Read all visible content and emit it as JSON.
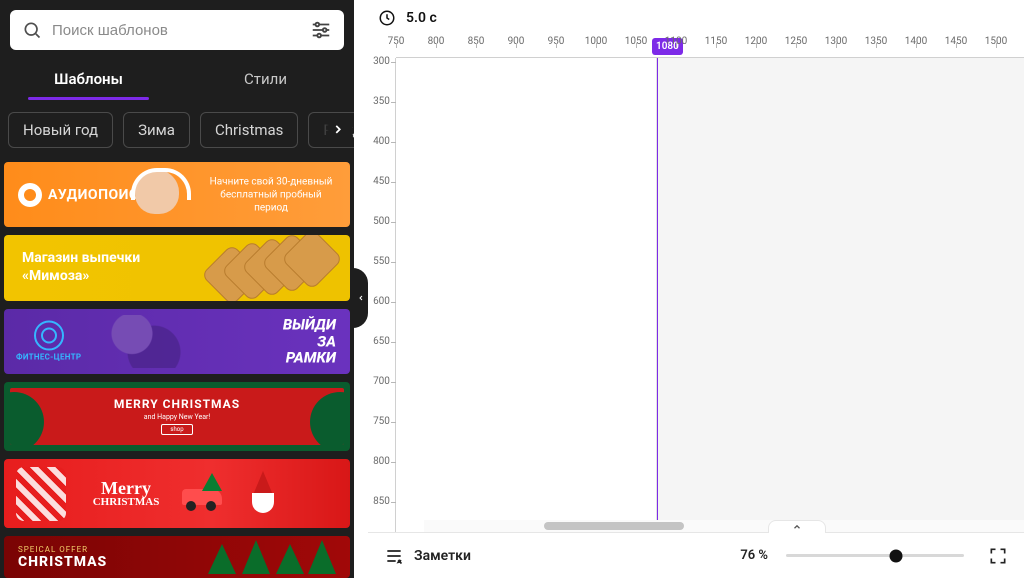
{
  "search": {
    "placeholder": "Поиск шаблонов"
  },
  "tabs": {
    "templates": "Шаблоны",
    "styles": "Стили"
  },
  "chips": [
    "Новый год",
    "Зима",
    "Christmas",
    "Рождес"
  ],
  "templates": {
    "t1": {
      "logo": "АУДИОПОИСК",
      "text": "Начните свой 30-дневный бесплатный пробный период"
    },
    "t2": {
      "line1": "Магазин выпечки",
      "line2": "«Мимоза»"
    },
    "t3": {
      "logo": "ФИТНЕС-ЦЕНТР",
      "line1": "ВЫЙДИ",
      "line2": "ЗА",
      "line3": "РАМКИ"
    },
    "t4": {
      "title": "MERRY CHRISTMAS",
      "sub": "and Happy New Year!",
      "btn": "shop"
    },
    "t5": {
      "line1": "Merry",
      "line2": "CHRISTMAS"
    },
    "t6": {
      "sub": "SPEICAL OFFER",
      "title": "CHRISTMAS"
    }
  },
  "duration": "5.0 с",
  "ruler": {
    "hTicks": [
      750,
      800,
      850,
      900,
      950,
      1000,
      1050,
      1100,
      1150,
      1200,
      1250,
      1300,
      1350,
      1400,
      1450,
      1500
    ],
    "hMarker": "1080",
    "vTicks": [
      300,
      350,
      400,
      450,
      500,
      550,
      600,
      650,
      700,
      750,
      800,
      850
    ]
  },
  "footer": {
    "notes": "Заметки",
    "zoom": "76 %"
  }
}
